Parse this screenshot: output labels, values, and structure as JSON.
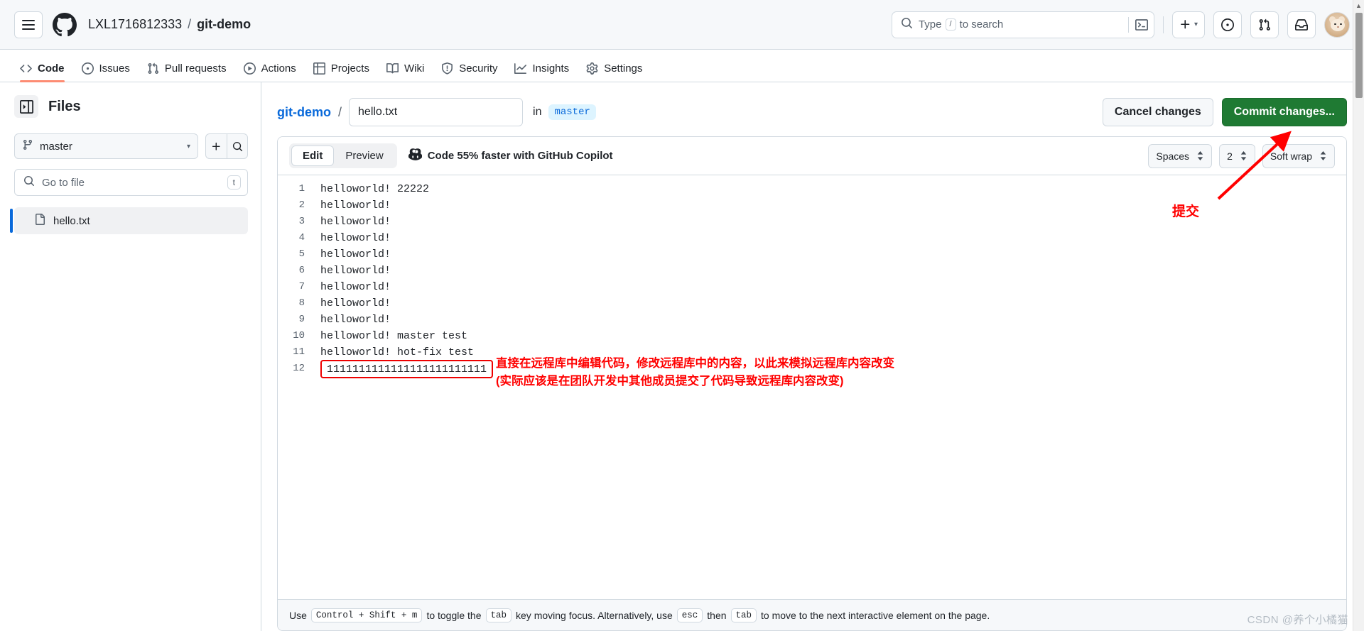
{
  "header": {
    "menu_icon": "hamburger-icon",
    "logo_icon": "github-logo-icon",
    "owner": "LXL1716812333",
    "separator": "/",
    "repo": "git-demo",
    "search": {
      "placeholder": "Type",
      "slash_key": "/",
      "placeholder_suffix": "to search",
      "icon": "search-icon",
      "terminal_icon": "terminal-icon"
    },
    "actions": {
      "create_new": "+",
      "create_caret": "▾",
      "issues_icon": "issue-opened-icon",
      "pull_requests_icon": "git-pull-request-icon",
      "inbox_icon": "inbox-icon",
      "avatar_alt": "user-avatar"
    }
  },
  "repo_nav": [
    {
      "label": "Code",
      "icon": "code-icon",
      "active": true
    },
    {
      "label": "Issues",
      "icon": "issue-opened-icon",
      "active": false
    },
    {
      "label": "Pull requests",
      "icon": "git-pull-request-icon",
      "active": false
    },
    {
      "label": "Actions",
      "icon": "play-icon",
      "active": false
    },
    {
      "label": "Projects",
      "icon": "table-icon",
      "active": false
    },
    {
      "label": "Wiki",
      "icon": "book-icon",
      "active": false
    },
    {
      "label": "Security",
      "icon": "shield-icon",
      "active": false
    },
    {
      "label": "Insights",
      "icon": "graph-icon",
      "active": false
    },
    {
      "label": "Settings",
      "icon": "gear-icon",
      "active": false
    }
  ],
  "sidebar": {
    "panel_toggle_icon": "sidebar-collapse-icon",
    "title": "Files",
    "branch": {
      "icon": "git-branch-icon",
      "name": "master",
      "caret": "▾"
    },
    "add_button_icon": "plus-icon",
    "search_button_icon": "search-icon",
    "go_to_file": {
      "icon": "search-icon",
      "placeholder": "Go to file",
      "shortcut": "t"
    },
    "files": [
      {
        "name": "hello.txt",
        "icon": "file-icon",
        "selected": true
      }
    ]
  },
  "path_bar": {
    "repo": "git-demo",
    "separator": "/",
    "filename_value": "hello.txt",
    "in_label": "in",
    "branch_chip": "master",
    "cancel_label": "Cancel changes",
    "commit_label": "Commit changes..."
  },
  "editor": {
    "tabs": [
      {
        "label": "Edit",
        "active": true
      },
      {
        "label": "Preview",
        "active": false
      }
    ],
    "copilot": {
      "icon": "copilot-icon",
      "text": "Code 55% faster with GitHub Copilot"
    },
    "settings": {
      "indent_mode": "Spaces",
      "indent_size": "2",
      "wrap_mode": "Soft wrap"
    },
    "lines": [
      {
        "num": "1",
        "text": "helloworld! 22222",
        "boxed": false
      },
      {
        "num": "2",
        "text": "helloworld!",
        "boxed": false
      },
      {
        "num": "3",
        "text": "helloworld!",
        "boxed": false
      },
      {
        "num": "4",
        "text": "helloworld!",
        "boxed": false
      },
      {
        "num": "5",
        "text": "helloworld!",
        "boxed": false
      },
      {
        "num": "6",
        "text": "helloworld!",
        "boxed": false
      },
      {
        "num": "7",
        "text": "helloworld!",
        "boxed": false
      },
      {
        "num": "8",
        "text": "helloworld!",
        "boxed": false
      },
      {
        "num": "9",
        "text": "helloworld!",
        "boxed": false
      },
      {
        "num": "10",
        "text": "helloworld! master test",
        "boxed": false
      },
      {
        "num": "11",
        "text": "helloworld! hot-fix test",
        "boxed": false
      },
      {
        "num": "12",
        "text": "1111111111111111111111111",
        "boxed": true
      }
    ],
    "footer": {
      "use": "Use",
      "kbd1": "Control + Shift + m",
      "mid1": "to toggle the",
      "kbd2": "tab",
      "mid2": "key moving focus. Alternatively, use",
      "kbd3": "esc",
      "mid3": "then",
      "kbd4": "tab",
      "mid4": "to move to the next interactive element on the page."
    }
  },
  "annotations": {
    "commit_label_cn": "提交",
    "note_line1": "直接在远程库中编辑代码，修改远程库中的内容，以此来模拟远程库内容改变",
    "note_line2": "(实际应该是在团队开发中其他成员提交了代码导致远程库内容改变)",
    "color": "#ff0000"
  },
  "watermark": "CSDN @养个小橘猫"
}
